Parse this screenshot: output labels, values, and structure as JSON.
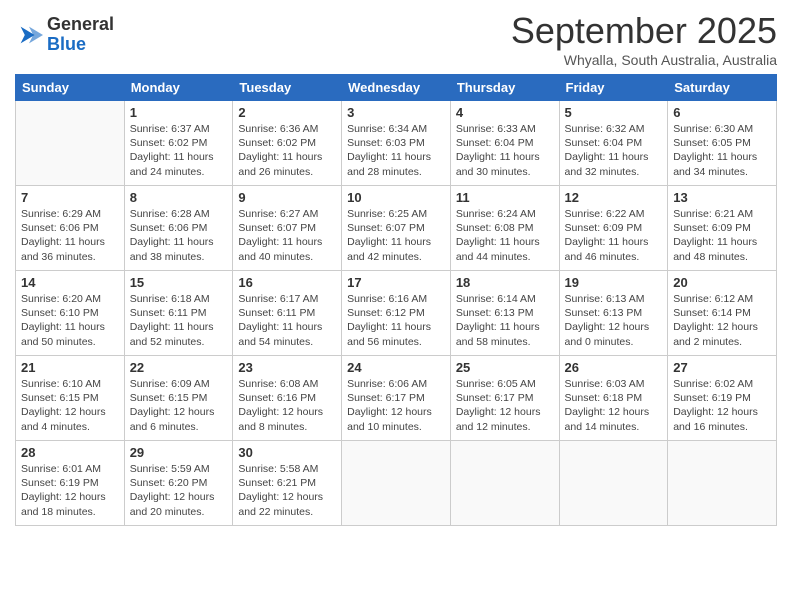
{
  "header": {
    "logo_line1": "General",
    "logo_line2": "Blue",
    "month": "September 2025",
    "location": "Whyalla, South Australia, Australia"
  },
  "days_of_week": [
    "Sunday",
    "Monday",
    "Tuesday",
    "Wednesday",
    "Thursday",
    "Friday",
    "Saturday"
  ],
  "weeks": [
    [
      {
        "day": "",
        "info": ""
      },
      {
        "day": "1",
        "info": "Sunrise: 6:37 AM\nSunset: 6:02 PM\nDaylight: 11 hours\nand 24 minutes."
      },
      {
        "day": "2",
        "info": "Sunrise: 6:36 AM\nSunset: 6:02 PM\nDaylight: 11 hours\nand 26 minutes."
      },
      {
        "day": "3",
        "info": "Sunrise: 6:34 AM\nSunset: 6:03 PM\nDaylight: 11 hours\nand 28 minutes."
      },
      {
        "day": "4",
        "info": "Sunrise: 6:33 AM\nSunset: 6:04 PM\nDaylight: 11 hours\nand 30 minutes."
      },
      {
        "day": "5",
        "info": "Sunrise: 6:32 AM\nSunset: 6:04 PM\nDaylight: 11 hours\nand 32 minutes."
      },
      {
        "day": "6",
        "info": "Sunrise: 6:30 AM\nSunset: 6:05 PM\nDaylight: 11 hours\nand 34 minutes."
      }
    ],
    [
      {
        "day": "7",
        "info": "Sunrise: 6:29 AM\nSunset: 6:06 PM\nDaylight: 11 hours\nand 36 minutes."
      },
      {
        "day": "8",
        "info": "Sunrise: 6:28 AM\nSunset: 6:06 PM\nDaylight: 11 hours\nand 38 minutes."
      },
      {
        "day": "9",
        "info": "Sunrise: 6:27 AM\nSunset: 6:07 PM\nDaylight: 11 hours\nand 40 minutes."
      },
      {
        "day": "10",
        "info": "Sunrise: 6:25 AM\nSunset: 6:07 PM\nDaylight: 11 hours\nand 42 minutes."
      },
      {
        "day": "11",
        "info": "Sunrise: 6:24 AM\nSunset: 6:08 PM\nDaylight: 11 hours\nand 44 minutes."
      },
      {
        "day": "12",
        "info": "Sunrise: 6:22 AM\nSunset: 6:09 PM\nDaylight: 11 hours\nand 46 minutes."
      },
      {
        "day": "13",
        "info": "Sunrise: 6:21 AM\nSunset: 6:09 PM\nDaylight: 11 hours\nand 48 minutes."
      }
    ],
    [
      {
        "day": "14",
        "info": "Sunrise: 6:20 AM\nSunset: 6:10 PM\nDaylight: 11 hours\nand 50 minutes."
      },
      {
        "day": "15",
        "info": "Sunrise: 6:18 AM\nSunset: 6:11 PM\nDaylight: 11 hours\nand 52 minutes."
      },
      {
        "day": "16",
        "info": "Sunrise: 6:17 AM\nSunset: 6:11 PM\nDaylight: 11 hours\nand 54 minutes."
      },
      {
        "day": "17",
        "info": "Sunrise: 6:16 AM\nSunset: 6:12 PM\nDaylight: 11 hours\nand 56 minutes."
      },
      {
        "day": "18",
        "info": "Sunrise: 6:14 AM\nSunset: 6:13 PM\nDaylight: 11 hours\nand 58 minutes."
      },
      {
        "day": "19",
        "info": "Sunrise: 6:13 AM\nSunset: 6:13 PM\nDaylight: 12 hours\nand 0 minutes."
      },
      {
        "day": "20",
        "info": "Sunrise: 6:12 AM\nSunset: 6:14 PM\nDaylight: 12 hours\nand 2 minutes."
      }
    ],
    [
      {
        "day": "21",
        "info": "Sunrise: 6:10 AM\nSunset: 6:15 PM\nDaylight: 12 hours\nand 4 minutes."
      },
      {
        "day": "22",
        "info": "Sunrise: 6:09 AM\nSunset: 6:15 PM\nDaylight: 12 hours\nand 6 minutes."
      },
      {
        "day": "23",
        "info": "Sunrise: 6:08 AM\nSunset: 6:16 PM\nDaylight: 12 hours\nand 8 minutes."
      },
      {
        "day": "24",
        "info": "Sunrise: 6:06 AM\nSunset: 6:17 PM\nDaylight: 12 hours\nand 10 minutes."
      },
      {
        "day": "25",
        "info": "Sunrise: 6:05 AM\nSunset: 6:17 PM\nDaylight: 12 hours\nand 12 minutes."
      },
      {
        "day": "26",
        "info": "Sunrise: 6:03 AM\nSunset: 6:18 PM\nDaylight: 12 hours\nand 14 minutes."
      },
      {
        "day": "27",
        "info": "Sunrise: 6:02 AM\nSunset: 6:19 PM\nDaylight: 12 hours\nand 16 minutes."
      }
    ],
    [
      {
        "day": "28",
        "info": "Sunrise: 6:01 AM\nSunset: 6:19 PM\nDaylight: 12 hours\nand 18 minutes."
      },
      {
        "day": "29",
        "info": "Sunrise: 5:59 AM\nSunset: 6:20 PM\nDaylight: 12 hours\nand 20 minutes."
      },
      {
        "day": "30",
        "info": "Sunrise: 5:58 AM\nSunset: 6:21 PM\nDaylight: 12 hours\nand 22 minutes."
      },
      {
        "day": "",
        "info": ""
      },
      {
        "day": "",
        "info": ""
      },
      {
        "day": "",
        "info": ""
      },
      {
        "day": "",
        "info": ""
      }
    ]
  ]
}
